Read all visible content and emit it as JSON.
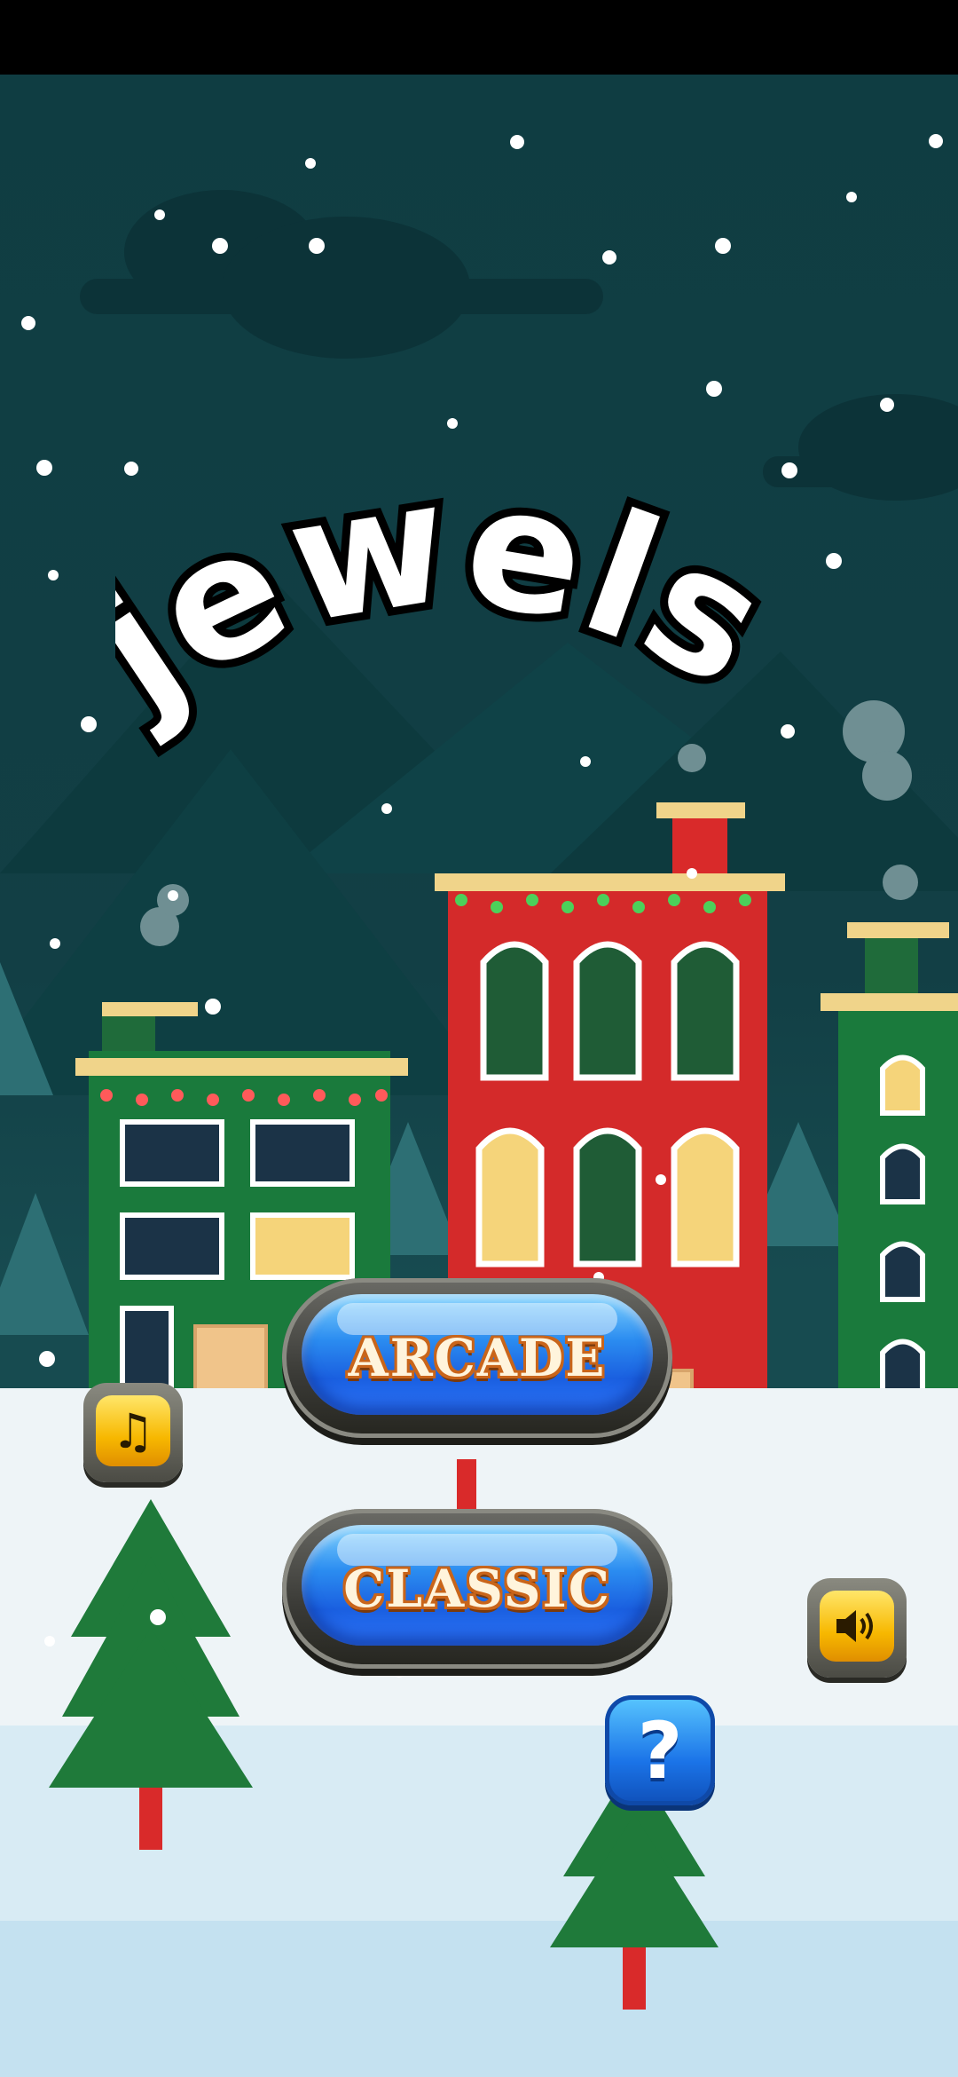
{
  "game": {
    "title": "jewels"
  },
  "menu": {
    "arcade_label": "ARCADE",
    "classic_label": "CLASSIC"
  },
  "icons": {
    "music": "music-note-icon",
    "sound": "speaker-icon",
    "help": "question-mark-icon"
  },
  "help": {
    "glyph": "?"
  },
  "colors": {
    "sky": "#123f45",
    "button_blue": "#1a5fe0",
    "button_text": "#fff4dc",
    "icon_gold": "#f7b800"
  }
}
